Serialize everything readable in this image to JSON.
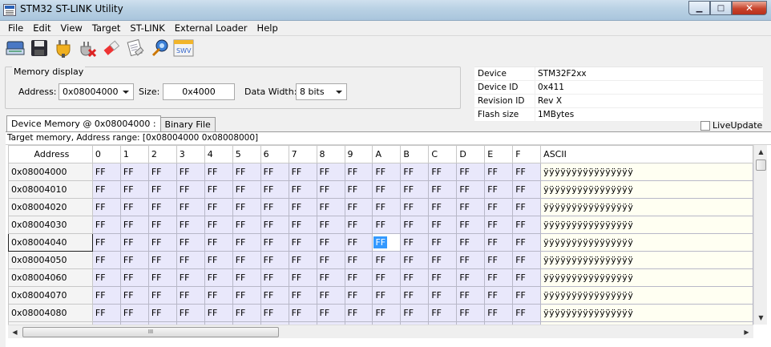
{
  "window": {
    "title": "STM32 ST-LINK Utility",
    "minimize_glyph": "▁",
    "maximize_glyph": "□",
    "close_glyph": "✕"
  },
  "menu": [
    "File",
    "Edit",
    "View",
    "Target",
    "ST-LINK",
    "External Loader",
    "Help"
  ],
  "toolbar": {
    "icons": [
      "connect-icon",
      "save-icon",
      "plug-icon",
      "disconnect-icon",
      "eraser-icon",
      "erase-sectors-icon",
      "program-icon",
      "swv-icon"
    ],
    "swv_label": "SWV"
  },
  "memory_display": {
    "legend": "Memory display",
    "address_label": "Address:",
    "address_value": "0x08004000",
    "size_label": "Size:",
    "size_value": "0x4000",
    "data_width_label": "Data Width:",
    "data_width_value": "8 bits"
  },
  "device_info": [
    {
      "key": "Device",
      "value": "STM32F2xx"
    },
    {
      "key": "Device ID",
      "value": "0x411"
    },
    {
      "key": "Revision ID",
      "value": "Rev X"
    },
    {
      "key": "Flash size",
      "value": "1MBytes"
    }
  ],
  "tabs": [
    "Device Memory @ 0x08004000 :",
    "Binary File"
  ],
  "live_update": "LiveUpdate",
  "range_text": "Target memory, Address range: [0x08004000 0x08008000]",
  "grid": {
    "headers": [
      "Address",
      "0",
      "1",
      "2",
      "3",
      "4",
      "5",
      "6",
      "7",
      "8",
      "9",
      "A",
      "B",
      "C",
      "D",
      "E",
      "F",
      "ASCII"
    ],
    "rows": [
      {
        "address": "0x08004000",
        "ascii": "ÿÿÿÿÿÿÿÿÿÿÿÿÿÿÿÿ"
      },
      {
        "address": "0x08004010",
        "ascii": "ÿÿÿÿÿÿÿÿÿÿÿÿÿÿÿÿ"
      },
      {
        "address": "0x08004020",
        "ascii": "ÿÿÿÿÿÿÿÿÿÿÿÿÿÿÿÿ"
      },
      {
        "address": "0x08004030",
        "ascii": "ÿÿÿÿÿÿÿÿÿÿÿÿÿÿÿÿ"
      },
      {
        "address": "0x08004040",
        "ascii": "ÿÿÿÿÿÿÿÿÿÿÿÿÿÿÿÿ"
      },
      {
        "address": "0x08004050",
        "ascii": "ÿÿÿÿÿÿÿÿÿÿÿÿÿÿÿÿ"
      },
      {
        "address": "0x08004060",
        "ascii": "ÿÿÿÿÿÿÿÿÿÿÿÿÿÿÿÿ"
      },
      {
        "address": "0x08004070",
        "ascii": "ÿÿÿÿÿÿÿÿÿÿÿÿÿÿÿÿ"
      },
      {
        "address": "0x08004080",
        "ascii": "ÿÿÿÿÿÿÿÿÿÿÿÿÿÿÿÿ"
      },
      {
        "address": "",
        "ascii": ""
      }
    ],
    "byte_value": "FF",
    "selected_row": 4,
    "selected_col": 10
  },
  "hscroll_grip": "III",
  "colors": {
    "hex_cell": "#e9e8fb",
    "ascii_cell": "#fffff2",
    "selection": "#3399ff"
  }
}
